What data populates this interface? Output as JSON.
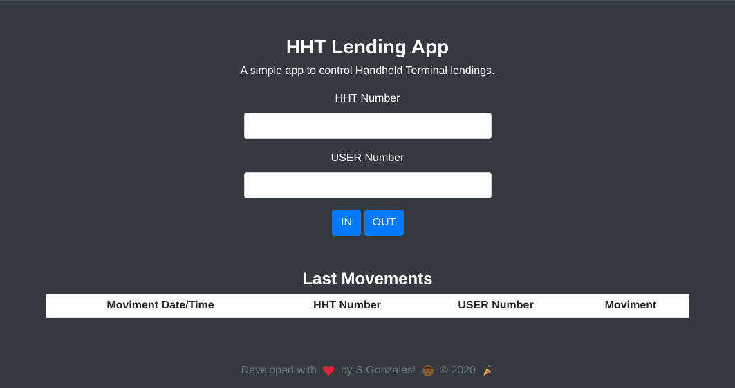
{
  "app": {
    "title": "HHT Lending App",
    "subtitle": "A simple app to control Handheld Terminal lendings."
  },
  "form": {
    "hht_label": "HHT Number",
    "hht_value": "",
    "user_label": "USER Number",
    "user_value": "",
    "in_label": "IN",
    "out_label": "OUT"
  },
  "movements": {
    "title": "Last Movements",
    "columns": [
      "Moviment Date/Time",
      "HHT Number",
      "USER Number",
      "Moviment"
    ],
    "rows": []
  },
  "footer": {
    "prefix": "Developed with",
    "by_text": "by S.Gonzales!",
    "copyright": "© 2020",
    "icons": [
      "heart-icon",
      "person-icon",
      "party-popper-icon"
    ]
  },
  "colors": {
    "background": "#343a40",
    "primary_button": "#007bff",
    "footer_text": "#6c757d",
    "heart": "#dc3545"
  }
}
